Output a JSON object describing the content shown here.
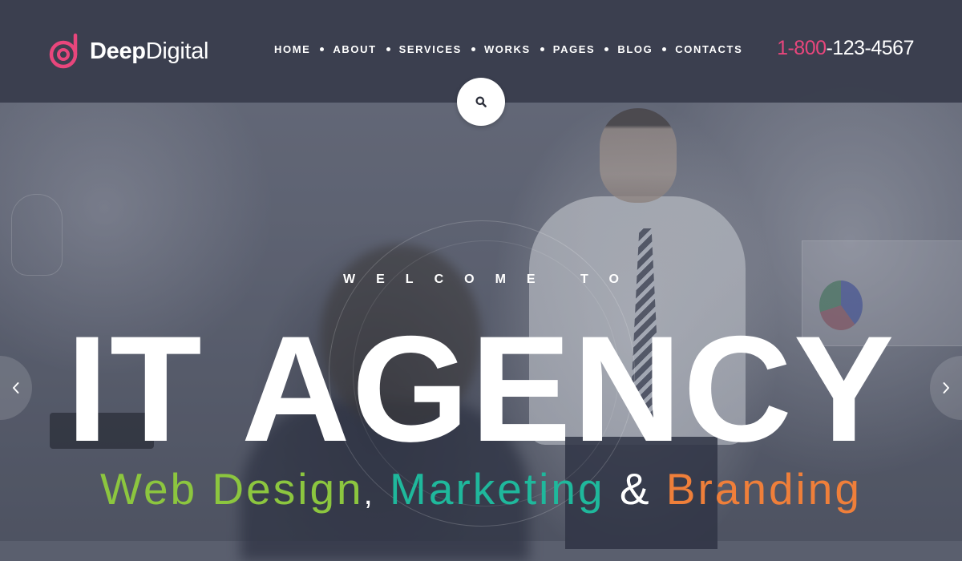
{
  "brand": {
    "name_bold": "Deep",
    "name_light": "Digital",
    "logo_icon": "deep-digital-logo-icon",
    "accent": "#e8467c"
  },
  "nav": {
    "items": [
      {
        "label": "HOME"
      },
      {
        "label": "ABOUT"
      },
      {
        "label": "SERVICES"
      },
      {
        "label": "WORKS"
      },
      {
        "label": "PAGES"
      },
      {
        "label": "BLOG"
      },
      {
        "label": "CONTACTS"
      }
    ]
  },
  "phone": {
    "prefix": "1-800",
    "number": "-123-4567"
  },
  "search": {
    "icon": "search-icon"
  },
  "hero": {
    "welcome": "WELCOME TO",
    "headline": "IT AGENCY",
    "sub_web": "Web Design",
    "sub_comma": ",",
    "sub_marketing": "Marketing",
    "sub_amp": "&",
    "sub_branding": "Branding",
    "colors": {
      "web": "#8cc63f",
      "marketing": "#1fb89c",
      "branding": "#ef7f3a"
    }
  },
  "slider": {
    "prev_icon": "chevron-left-icon",
    "next_icon": "chevron-right-icon"
  }
}
